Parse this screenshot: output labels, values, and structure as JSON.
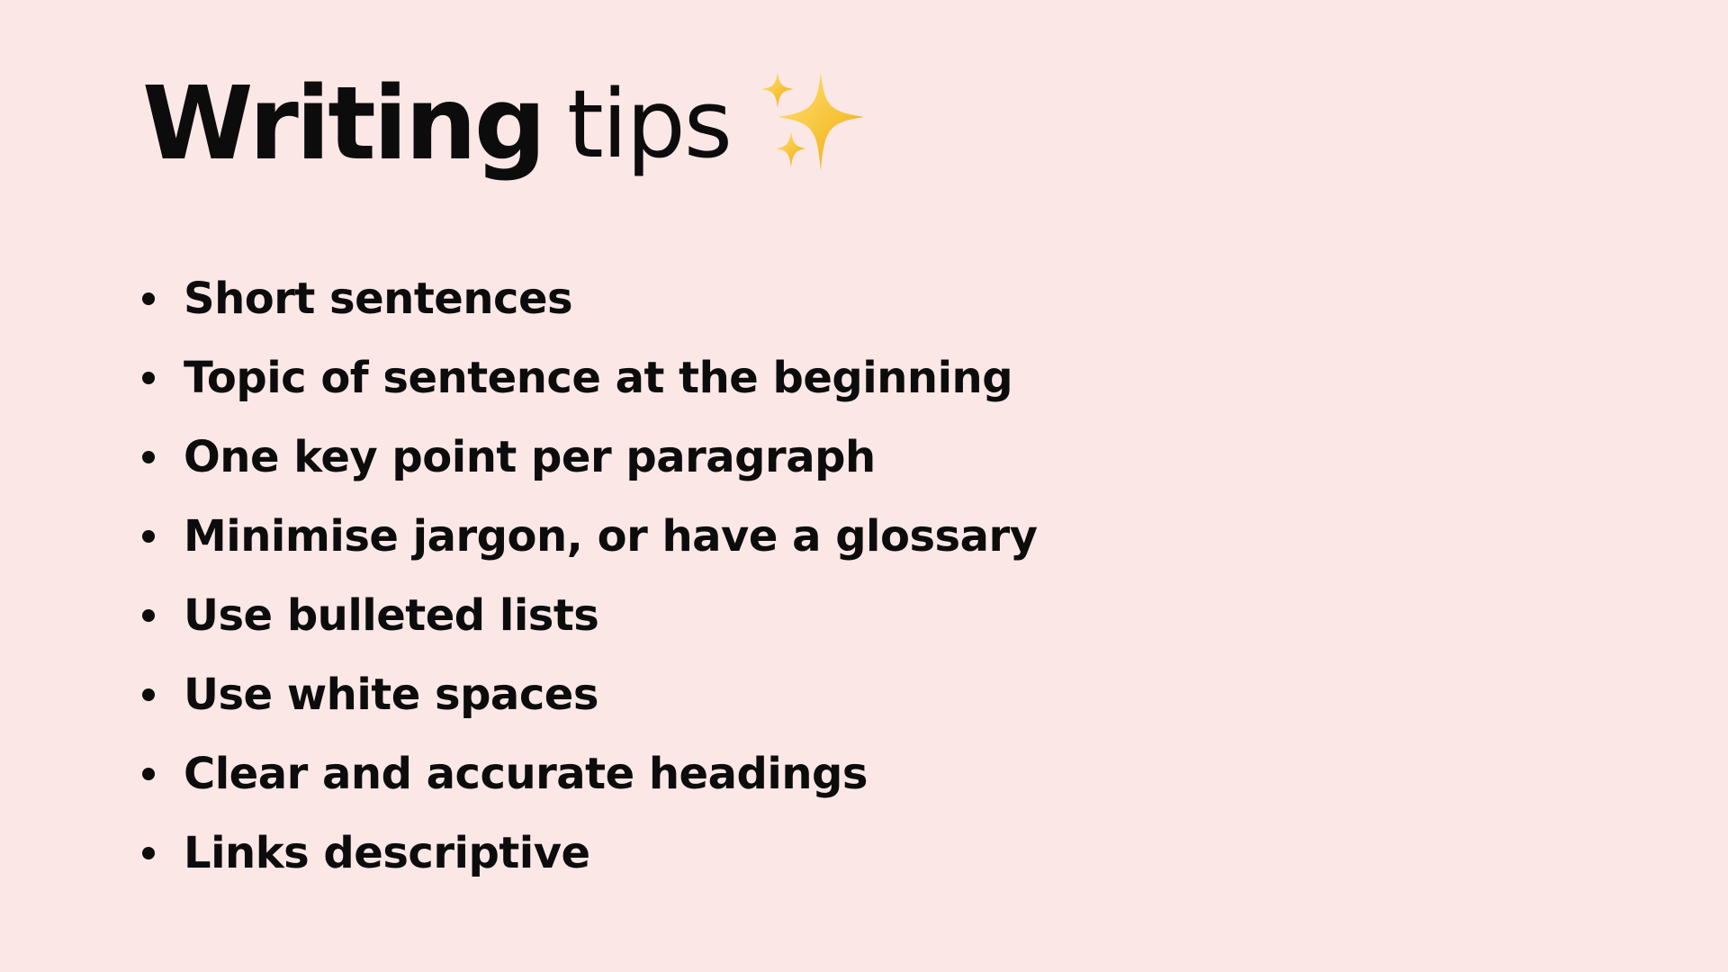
{
  "slide": {
    "background": "#fce7e7",
    "text_color": "#0c0c0c",
    "title": {
      "strong": "Writing",
      "light": "tips",
      "emoji_icon": "sparkles-icon"
    },
    "tips": [
      "Short sentences",
      "Topic of sentence at the beginning",
      "One key point per paragraph",
      "Minimise jargon, or have a glossary",
      "Use bulleted lists",
      "Use white spaces",
      "Clear and accurate headings",
      "Links descriptive"
    ]
  }
}
